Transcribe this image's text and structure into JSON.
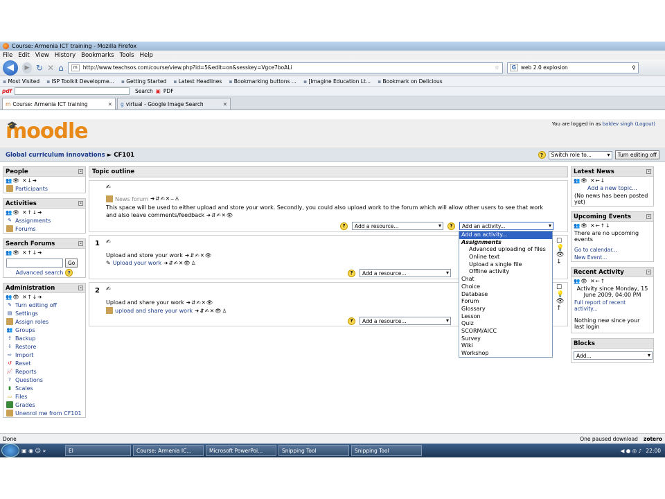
{
  "browser": {
    "title": "Course: Armenia ICT training - Mozilla Firefox",
    "menu": [
      "File",
      "Edit",
      "View",
      "History",
      "Bookmarks",
      "Tools",
      "Help"
    ],
    "url": "http://www.teachsos.com/course/view.php?id=5&edit=on&sesskey=Vgce7boALi",
    "search_engine": "G",
    "search_value": "web 2.0 explosion",
    "bookmarks": [
      "Most Visited",
      "ISP Toolkit Developme...",
      "Getting Started",
      "Latest Headlines",
      "Bookmarking buttons ...",
      "[Imagine Education Lt...",
      "Bookmark on Delicious"
    ],
    "pdf_logo": "pdf",
    "pdf_search": "Search",
    "pdf_label": "PDF",
    "tabs": [
      {
        "label": "Course: Armenia ICT training"
      },
      {
        "label": "virtual - Google Image Search"
      }
    ]
  },
  "moodle": {
    "logo": "moodle",
    "logged_in_prefix": "You are logged in as",
    "user": "baldev singh",
    "logout": "(Logout)",
    "breadcrumb_root": "Global curriculum innovations",
    "breadcrumb_sep": "►",
    "breadcrumb_current": "CF101",
    "switch_role": "Switch role to...",
    "turn_editing_off": "Turn editing off"
  },
  "left": {
    "people": {
      "title": "People",
      "items": [
        "Participants"
      ]
    },
    "activities": {
      "title": "Activities",
      "items": [
        "Assignments",
        "Forums"
      ]
    },
    "search": {
      "title": "Search Forums",
      "go": "Go",
      "advanced": "Advanced search"
    },
    "admin": {
      "title": "Administration",
      "items": [
        "Turn editing off",
        "Settings",
        "Assign roles",
        "Groups",
        "Backup",
        "Restore",
        "Import",
        "Reset",
        "Reports",
        "Questions",
        "Scales",
        "Files",
        "Grades",
        "Unenrol me from CF101"
      ]
    }
  },
  "center": {
    "topic_outline": "Topic outline",
    "news_forum": "News forum",
    "summary": "This space will be used to either upload and store your work. Secondly, you could also upload work to the forum which will allow other users to see that work and also leave comments/feedback",
    "add_resource": "Add a resource...",
    "add_activity": "Add an activity...",
    "section1": {
      "num": "1",
      "title": "Upload and store your work",
      "link": "Upload your work"
    },
    "section2": {
      "num": "2",
      "title": "Upload and share your work",
      "link": "upload and share your work"
    }
  },
  "dropdown": [
    "Add an activity...",
    "Assignments",
    "Advanced uploading of files",
    "Online text",
    "Upload a single file",
    "Offline activity",
    "Chat",
    "Choice",
    "Database",
    "Forum",
    "Glossary",
    "Lesson",
    "Quiz",
    "SCORM/AICC",
    "Survey",
    "Wiki",
    "Workshop"
  ],
  "right": {
    "news": {
      "title": "Latest News",
      "add": "Add a new topic...",
      "empty": "(No news has been posted yet)"
    },
    "events": {
      "title": "Upcoming Events",
      "empty": "There are no upcoming events",
      "calendar": "Go to calendar...",
      "new_event": "New Event..."
    },
    "recent": {
      "title": "Recent Activity",
      "since": "Activity since Monday, 15 June 2009, 04:00 PM",
      "full": "Full report of recent activity...",
      "none": "Nothing new since your last login"
    },
    "blocks": {
      "title": "Blocks",
      "add": "Add..."
    }
  },
  "status": {
    "left": "Done",
    "download": "One paused download",
    "zotero": "zotero"
  },
  "taskbar": {
    "items": [
      "El",
      "Course: Armenia IC...",
      "Microsoft PowerPoi...",
      "Snipping Tool",
      "Snipping Tool"
    ],
    "clock": "22:00"
  }
}
